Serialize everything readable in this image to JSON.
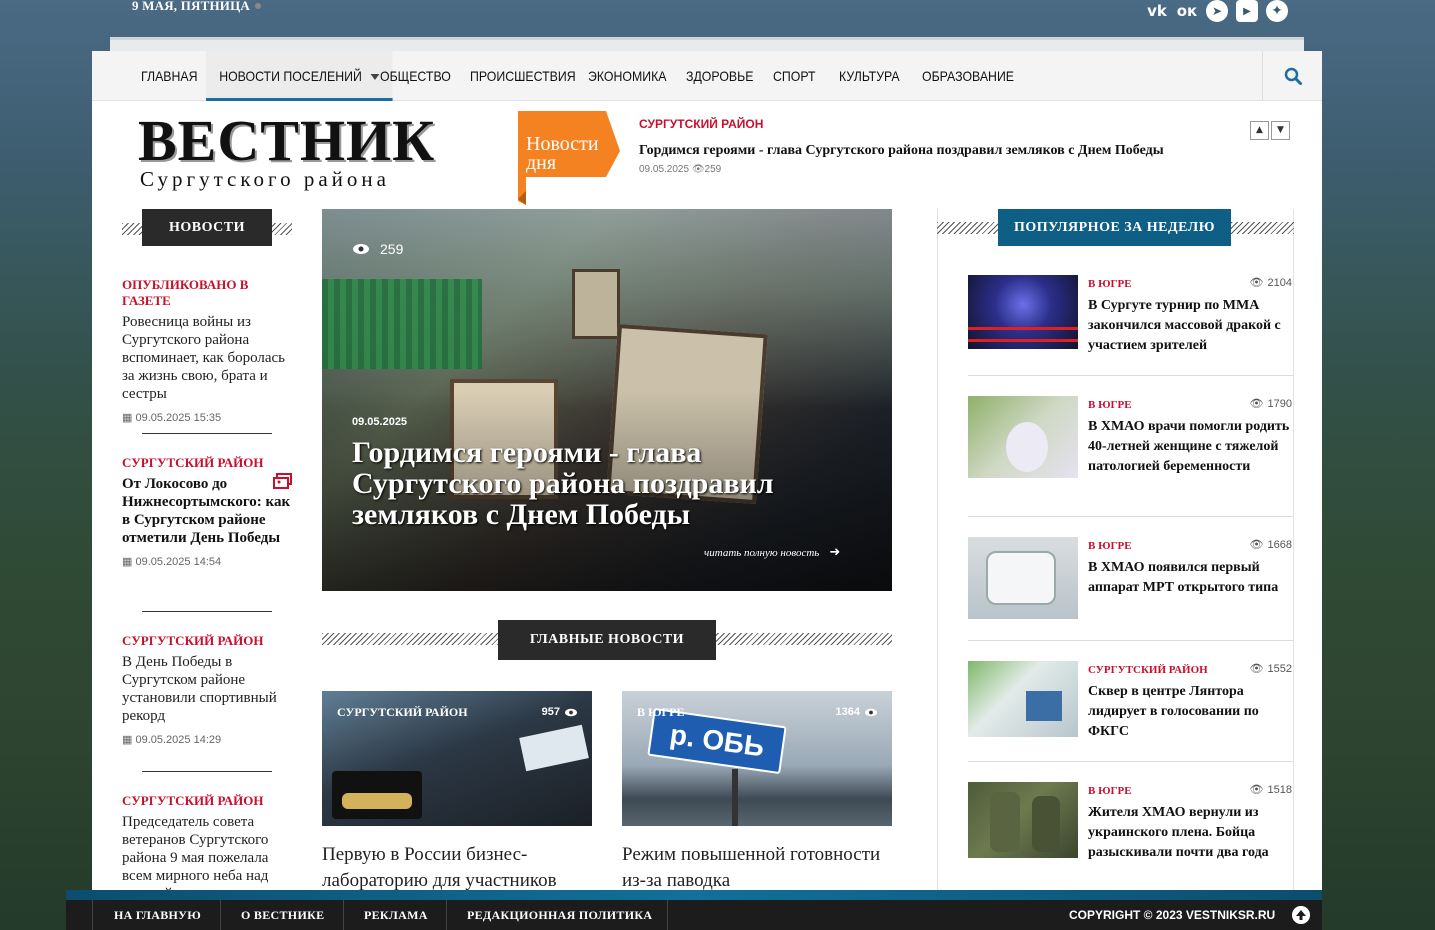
{
  "topbar": {
    "date": "9 МАЯ, ПЯТНИЦА",
    "social_icons": [
      "vk-icon",
      "odnoklassniki-icon",
      "telegram-icon",
      "rutube-icon",
      "zen-icon"
    ],
    "youtube_small": "Rutube"
  },
  "nav": {
    "items": [
      "ГЛАВНАЯ",
      "НОВОСТИ ПОСЕЛЕНИЙ",
      "ОБЩЕСТВО",
      "ПРОИСШЕСТВИЯ",
      "ЭКОНОМИКА",
      "ЗДОРОВЬЕ",
      "СПОРТ",
      "КУЛЬТУРА",
      "ОБРАЗОВАНИЕ"
    ],
    "active": "НОВОСТИ ПОСЕЛЕНИЙ"
  },
  "logo": {
    "title": "ВЕСТНИК",
    "subtitle": "Сургутского района"
  },
  "ticker": {
    "badge_line1": "Новости",
    "badge_line2": "дня",
    "category": "СУРГУТСКИЙ РАЙОН",
    "title": "Гордимся героями - глава Сургутского района поздравил земляков с Днем Победы",
    "meta": "09.05.2025 👁259"
  },
  "left": {
    "heading": "НОВОСТИ",
    "items": [
      {
        "category": "ОПУБЛИКОВАНО В ГАЗЕТЕ",
        "title": "Ровесница войны из Сургутского района вспоминает, как боролась за жизнь свою, брата и сестры",
        "date": "09.05.2025 15:35"
      },
      {
        "category": "СУРГУТСКИЙ РАЙОН",
        "title": "От Локосово до Нижнесортымского: как в Сургутском районе отметили День Победы",
        "date": "09.05.2025 14:54"
      },
      {
        "category": "СУРГУТСКИЙ РАЙОН",
        "title": "В День Победы в Сургутском районе установили спортивный рекорд",
        "date": "09.05.2025 14:29"
      },
      {
        "category": "СУРГУТСКИЙ РАЙОН",
        "title": "Председатель совета ветеранов Сургутского района 9 мая пожелала всем мирного неба над головой"
      }
    ]
  },
  "hero": {
    "views": "259",
    "date": "09.05.2025",
    "title": "Гордимся героями - глава Сургутского района поздравил земляков с Днем Победы",
    "more": "читать полную новость"
  },
  "main_news": {
    "heading": "ГЛАВНЫЕ НОВОСТИ",
    "cards": [
      {
        "category": "СУРГУТСКИЙ РАЙОН",
        "views": "957",
        "title": "Первую в России бизнес-лабораторию для участников"
      },
      {
        "category": "В ЮГРЕ",
        "views": "1364",
        "title": "Режим повышенной готовности из-за паводка",
        "sign": "р. ОБЬ"
      }
    ]
  },
  "popular": {
    "heading": "ПОПУЛЯРНОЕ ЗА НЕДЕЛЮ",
    "items": [
      {
        "category": "В ЮГРЕ",
        "views": "2104",
        "title": "В Сургуте турнир по ММА закончился массовой дракой с участием зрителей"
      },
      {
        "category": "В ЮГРЕ",
        "views": "1790",
        "title": "В ХМАО врачи помогли родить 40-летней женщине с тяжелой патологией беременности"
      },
      {
        "category": "В ЮГРЕ",
        "views": "1668",
        "title": "В ХМАО появился первый аппарат МРТ открытого типа"
      },
      {
        "category": "СУРГУТСКИЙ РАЙОН",
        "views": "1552",
        "title": "Сквер в центре Лянтора лидирует в голосовании по ФКГС"
      },
      {
        "category": "В ЮГРЕ",
        "views": "1518",
        "title": "Жителя ХМАО вернули из украинского плена. Бойца разыскивали почти два года"
      }
    ]
  },
  "footer": {
    "links": [
      "НА ГЛАВНУЮ",
      "О ВЕСТНИКЕ",
      "РЕКЛАМА",
      "РЕДАКЦИОННАЯ ПОЛИТИКА"
    ],
    "copyright": "COPYRIGHT © 2023 VESTNIKSR.RU"
  },
  "colors": {
    "accent_red": "#c8102e",
    "accent_blue": "#0f5e86",
    "badge_orange": "#f58220"
  }
}
